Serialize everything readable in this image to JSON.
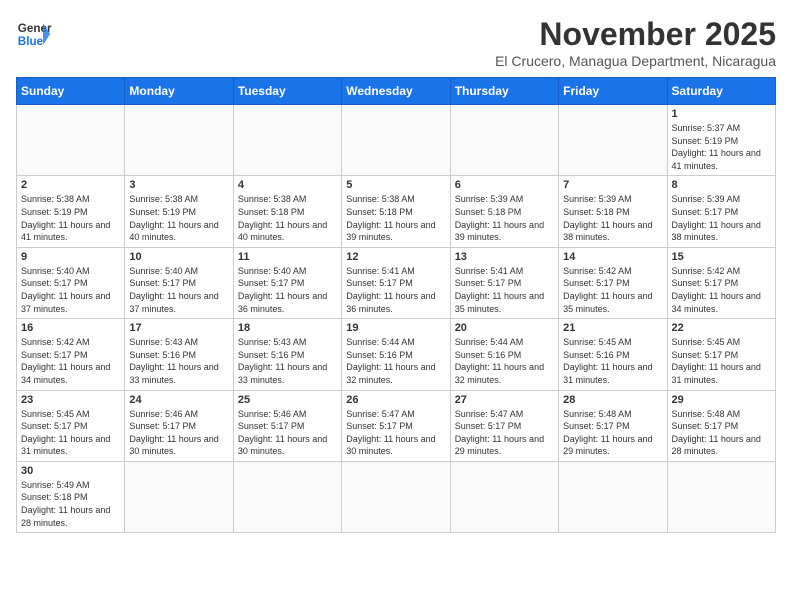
{
  "header": {
    "logo_line1": "General",
    "logo_line2": "Blue",
    "month_title": "November 2025",
    "location": "El Crucero, Managua Department, Nicaragua"
  },
  "weekdays": [
    "Sunday",
    "Monday",
    "Tuesday",
    "Wednesday",
    "Thursday",
    "Friday",
    "Saturday"
  ],
  "weeks": [
    [
      {
        "day": "",
        "info": ""
      },
      {
        "day": "",
        "info": ""
      },
      {
        "day": "",
        "info": ""
      },
      {
        "day": "",
        "info": ""
      },
      {
        "day": "",
        "info": ""
      },
      {
        "day": "",
        "info": ""
      },
      {
        "day": "1",
        "info": "Sunrise: 5:37 AM\nSunset: 5:19 PM\nDaylight: 11 hours and 41 minutes."
      }
    ],
    [
      {
        "day": "2",
        "info": "Sunrise: 5:38 AM\nSunset: 5:19 PM\nDaylight: 11 hours and 41 minutes."
      },
      {
        "day": "3",
        "info": "Sunrise: 5:38 AM\nSunset: 5:19 PM\nDaylight: 11 hours and 40 minutes."
      },
      {
        "day": "4",
        "info": "Sunrise: 5:38 AM\nSunset: 5:18 PM\nDaylight: 11 hours and 40 minutes."
      },
      {
        "day": "5",
        "info": "Sunrise: 5:38 AM\nSunset: 5:18 PM\nDaylight: 11 hours and 39 minutes."
      },
      {
        "day": "6",
        "info": "Sunrise: 5:39 AM\nSunset: 5:18 PM\nDaylight: 11 hours and 39 minutes."
      },
      {
        "day": "7",
        "info": "Sunrise: 5:39 AM\nSunset: 5:18 PM\nDaylight: 11 hours and 38 minutes."
      },
      {
        "day": "8",
        "info": "Sunrise: 5:39 AM\nSunset: 5:17 PM\nDaylight: 11 hours and 38 minutes."
      }
    ],
    [
      {
        "day": "9",
        "info": "Sunrise: 5:40 AM\nSunset: 5:17 PM\nDaylight: 11 hours and 37 minutes."
      },
      {
        "day": "10",
        "info": "Sunrise: 5:40 AM\nSunset: 5:17 PM\nDaylight: 11 hours and 37 minutes."
      },
      {
        "day": "11",
        "info": "Sunrise: 5:40 AM\nSunset: 5:17 PM\nDaylight: 11 hours and 36 minutes."
      },
      {
        "day": "12",
        "info": "Sunrise: 5:41 AM\nSunset: 5:17 PM\nDaylight: 11 hours and 36 minutes."
      },
      {
        "day": "13",
        "info": "Sunrise: 5:41 AM\nSunset: 5:17 PM\nDaylight: 11 hours and 35 minutes."
      },
      {
        "day": "14",
        "info": "Sunrise: 5:42 AM\nSunset: 5:17 PM\nDaylight: 11 hours and 35 minutes."
      },
      {
        "day": "15",
        "info": "Sunrise: 5:42 AM\nSunset: 5:17 PM\nDaylight: 11 hours and 34 minutes."
      }
    ],
    [
      {
        "day": "16",
        "info": "Sunrise: 5:42 AM\nSunset: 5:17 PM\nDaylight: 11 hours and 34 minutes."
      },
      {
        "day": "17",
        "info": "Sunrise: 5:43 AM\nSunset: 5:16 PM\nDaylight: 11 hours and 33 minutes."
      },
      {
        "day": "18",
        "info": "Sunrise: 5:43 AM\nSunset: 5:16 PM\nDaylight: 11 hours and 33 minutes."
      },
      {
        "day": "19",
        "info": "Sunrise: 5:44 AM\nSunset: 5:16 PM\nDaylight: 11 hours and 32 minutes."
      },
      {
        "day": "20",
        "info": "Sunrise: 5:44 AM\nSunset: 5:16 PM\nDaylight: 11 hours and 32 minutes."
      },
      {
        "day": "21",
        "info": "Sunrise: 5:45 AM\nSunset: 5:16 PM\nDaylight: 11 hours and 31 minutes."
      },
      {
        "day": "22",
        "info": "Sunrise: 5:45 AM\nSunset: 5:17 PM\nDaylight: 11 hours and 31 minutes."
      }
    ],
    [
      {
        "day": "23",
        "info": "Sunrise: 5:45 AM\nSunset: 5:17 PM\nDaylight: 11 hours and 31 minutes."
      },
      {
        "day": "24",
        "info": "Sunrise: 5:46 AM\nSunset: 5:17 PM\nDaylight: 11 hours and 30 minutes."
      },
      {
        "day": "25",
        "info": "Sunrise: 5:46 AM\nSunset: 5:17 PM\nDaylight: 11 hours and 30 minutes."
      },
      {
        "day": "26",
        "info": "Sunrise: 5:47 AM\nSunset: 5:17 PM\nDaylight: 11 hours and 30 minutes."
      },
      {
        "day": "27",
        "info": "Sunrise: 5:47 AM\nSunset: 5:17 PM\nDaylight: 11 hours and 29 minutes."
      },
      {
        "day": "28",
        "info": "Sunrise: 5:48 AM\nSunset: 5:17 PM\nDaylight: 11 hours and 29 minutes."
      },
      {
        "day": "29",
        "info": "Sunrise: 5:48 AM\nSunset: 5:17 PM\nDaylight: 11 hours and 28 minutes."
      }
    ],
    [
      {
        "day": "30",
        "info": "Sunrise: 5:49 AM\nSunset: 5:18 PM\nDaylight: 11 hours and 28 minutes."
      },
      {
        "day": "",
        "info": ""
      },
      {
        "day": "",
        "info": ""
      },
      {
        "day": "",
        "info": ""
      },
      {
        "day": "",
        "info": ""
      },
      {
        "day": "",
        "info": ""
      },
      {
        "day": "",
        "info": ""
      }
    ]
  ]
}
